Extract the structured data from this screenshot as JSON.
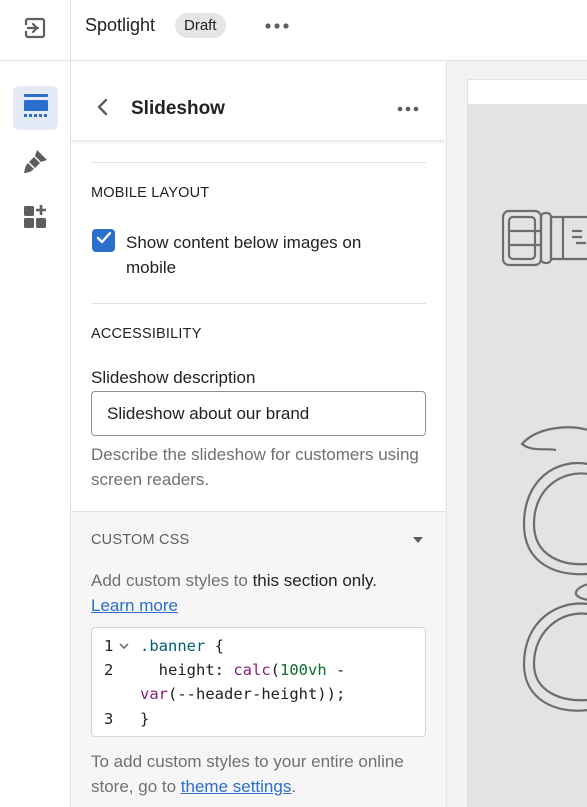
{
  "topbar": {
    "exit_icon": "exit-icon",
    "theme_name": "Spotlight",
    "status_badge": "Draft",
    "more_icon": "more-horizontal-icon"
  },
  "rail": {
    "items": [
      {
        "icon": "sections-icon",
        "active": true
      },
      {
        "icon": "paintbrush-icon",
        "active": false
      },
      {
        "icon": "apps-icon",
        "active": false
      }
    ],
    "active_color": "#2c6ecb",
    "inactive_color": "#5c5f62"
  },
  "panel": {
    "back_icon": "chevron-left-icon",
    "title": "Slideshow",
    "more_icon": "more-horizontal-icon",
    "mobile_layout": {
      "heading": "MOBILE LAYOUT",
      "checkbox_checked": true,
      "checkbox_label": "Show content below images on mobile"
    },
    "accessibility": {
      "heading": "ACCESSIBILITY",
      "field_label": "Slideshow description",
      "field_value": "Slideshow about our brand",
      "help_text": "Describe the slideshow for customers using screen readers."
    },
    "custom_css": {
      "heading": "CUSTOM CSS",
      "caret_icon": "caret-down-icon",
      "intro_prefix": "Add custom styles to ",
      "intro_emphasis": "this section only.",
      "learn_more": "Learn more",
      "code_lines": [
        {
          "n": "1",
          "text": ".banner {"
        },
        {
          "n": "2",
          "text": "  height: calc(100vh -"
        },
        {
          "n": "",
          "text": "var(--header-height));"
        },
        {
          "n": "3",
          "text": "}"
        }
      ],
      "footer_prefix": "To add custom styles to your entire online store, go to ",
      "footer_link": "theme settings",
      "footer_suffix": "."
    }
  },
  "preview": {
    "illustrations": [
      "belt-icon",
      "glasses-icon"
    ]
  },
  "colors": {
    "accent": "#2c6ecb",
    "border": "#e1e3e5",
    "custom_css_bg": "#f6f6f7"
  }
}
